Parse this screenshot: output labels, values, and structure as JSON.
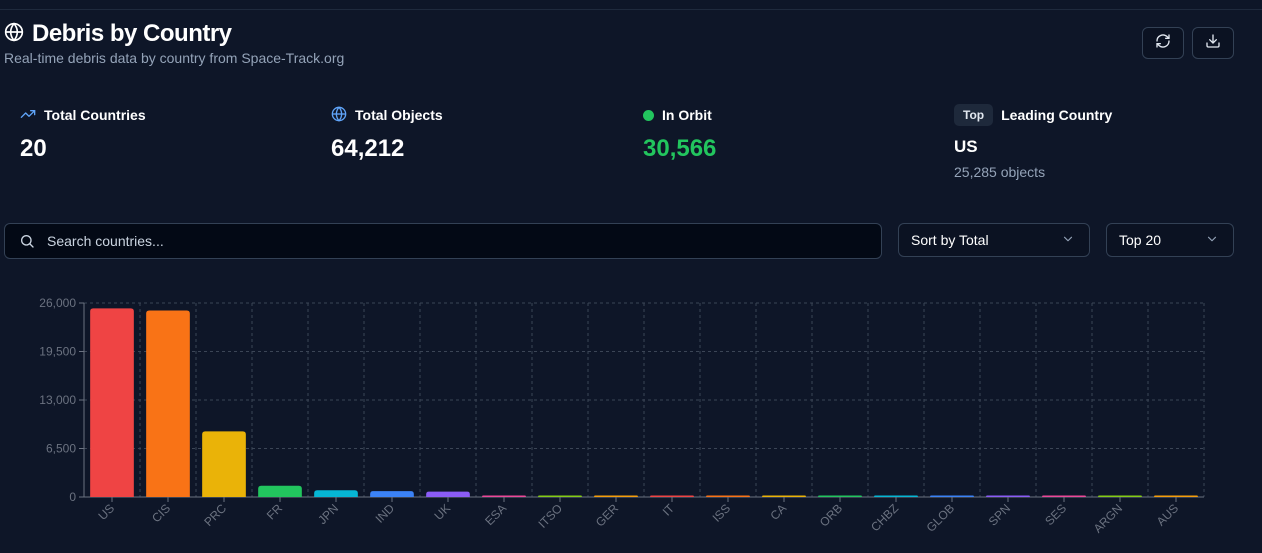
{
  "header": {
    "title": "Debris by Country",
    "subtitle": "Real-time debris data by country from Space-Track.org"
  },
  "toolbar": {
    "refresh_icon": "refresh-icon",
    "download_icon": "download-icon"
  },
  "stats": {
    "total_countries": {
      "label": "Total Countries",
      "value": "20",
      "icon": "trending-up-icon"
    },
    "total_objects": {
      "label": "Total Objects",
      "value": "64,212",
      "icon": "globe-icon"
    },
    "in_orbit": {
      "label": "In Orbit",
      "value": "30,566",
      "icon": "status-dot"
    },
    "leading": {
      "badge": "Top",
      "label": "Leading Country",
      "country": "US",
      "objects": "25,285 objects"
    }
  },
  "search": {
    "placeholder": "Search countries..."
  },
  "sort": {
    "selected": "Sort by Total"
  },
  "limit": {
    "selected": "Top 20"
  },
  "colors": {
    "accent_green": "#22c55e",
    "accent_blue": "#60a5fa",
    "background": "#0e1628"
  },
  "chart_data": {
    "type": "bar",
    "categories": [
      "US",
      "CIS",
      "PRC",
      "FR",
      "JPN",
      "IND",
      "UK",
      "ESA",
      "ITSO",
      "GER",
      "IT",
      "ISS",
      "CA",
      "ORB",
      "CHBZ",
      "GLOB",
      "SPN",
      "SES",
      "ARGN",
      "AUS"
    ],
    "values": [
      25285,
      25000,
      8800,
      1500,
      900,
      780,
      720,
      160,
      100,
      90,
      80,
      70,
      60,
      50,
      45,
      40,
      35,
      30,
      25,
      20
    ],
    "colors": [
      "#ef4444",
      "#f97316",
      "#eab308",
      "#22c55e",
      "#06b6d4",
      "#3b82f6",
      "#8b5cf6",
      "#ec4899",
      "#84cc16",
      "#f59e0b",
      "#ef4444",
      "#f97316",
      "#eab308",
      "#22c55e",
      "#06b6d4",
      "#3b82f6",
      "#8b5cf6",
      "#ec4899",
      "#84cc16",
      "#f59e0b"
    ],
    "y_ticks": [
      "26,000",
      "19,500",
      "13,000",
      "6,500",
      "0"
    ],
    "ylim": [
      0,
      26000
    ],
    "grid": true
  }
}
